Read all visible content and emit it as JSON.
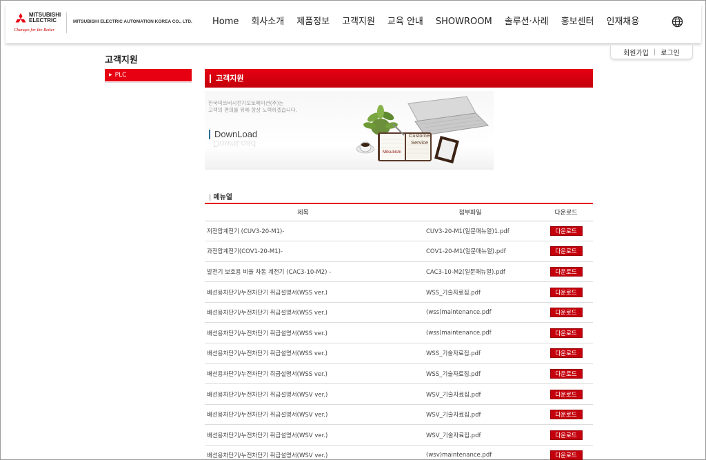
{
  "header": {
    "logo_text": "MITSUBISHI ELECTRIC",
    "logo_tagline": "Changes for the Better",
    "company_name": "MITSUBISHI ELECTRIC AUTOMATION KOREA CO., LTD.",
    "nav": [
      "Home",
      "회사소개",
      "제품정보",
      "고객지원",
      "교육 안내",
      "SHOWROOM",
      "솔루션·사례",
      "홍보센터",
      "인재채용"
    ],
    "globe_icon": "globe-icon"
  },
  "member": {
    "join": "회원가입",
    "login": "로그인"
  },
  "page_title": "고객지원",
  "side_menu": {
    "active_item": "PLC"
  },
  "section_title": "고객지원",
  "banner": {
    "line1": "한국미쓰비시전기오토메이션(주)는",
    "line2": "고객의 편의를 위해 항상 노력하겠습니다.",
    "download_text": "DownLoad",
    "card_brand": "Mitsubishi",
    "card_line1": "Customer",
    "card_line2": "Service"
  },
  "list": {
    "title": "메뉴얼",
    "columns": [
      "제목",
      "첨부파일",
      "다운로드"
    ],
    "rows": [
      {
        "title": "저전압계전기 (CUV3-20-M1)-",
        "file": "CUV3-20-M1(일문매뉴얼)1.pdf",
        "button": "다운로드"
      },
      {
        "title": "과전압계전기(COV1-20-M1)-",
        "file": "COV1-20-M1(일문매뉴얼).pdf",
        "button": "다운로드"
      },
      {
        "title": "발전기 보호용 비율 차동 계전기 (CAC3-10-M2) -",
        "file": "CAC3-10-M2(일문매뉴얼).pdf",
        "button": "다운로드"
      },
      {
        "title": "배선용차단기/누전차단기 취급설명서(WSS ver.)",
        "file": "WSS_기술자료집.pdf",
        "button": "다운로드"
      },
      {
        "title": "배선용차단기/누전차단기 취급설명서(WSS ver.)",
        "file": "(wss)maintenance.pdf",
        "button": "다운로드"
      },
      {
        "title": "배선용차단기/누전차단기 취급설명서(WSS ver.)",
        "file": "(wss)maintenance.pdf",
        "button": "다운로드"
      },
      {
        "title": "배선용차단기/누전차단기 취급설명서(WSS ver.)",
        "file": "WSS_기술자료집.pdf",
        "button": "다운로드"
      },
      {
        "title": "배선용차단기/누전차단기 취급설명서(WSS ver.)",
        "file": "WSS_기술자료집.pdf",
        "button": "다운로드"
      },
      {
        "title": "배선용차단기/누전차단기 취급설명서(WSV ver.)",
        "file": "WSV_기술자료집.pdf",
        "button": "다운로드"
      },
      {
        "title": "배선용차단기/누전차단기 취급설명서(WSV ver.)",
        "file": "WSV_기술자료집.pdf",
        "button": "다운로드"
      },
      {
        "title": "배선용차단기/누전차단기 취급설명서(WSV ver.)",
        "file": "WSV_기술자료집.pdf",
        "button": "다운로드"
      },
      {
        "title": "배선용차단기/누전차단기 취급설명서(WSV ver.)",
        "file": "(wsv)maintenance.pdf",
        "button": "다운로드"
      }
    ]
  },
  "colors": {
    "accent": "#e60012",
    "button": "#c4000c"
  }
}
